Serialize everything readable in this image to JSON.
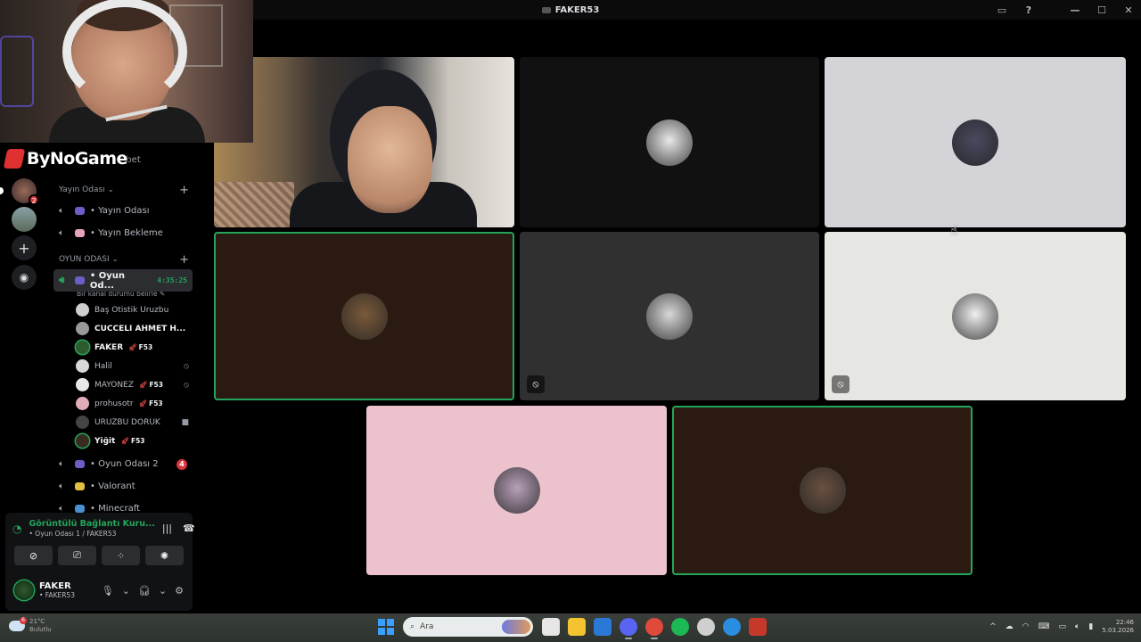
{
  "window": {
    "title": "FAKER53"
  },
  "overlay": {
    "brand": "ByNoGame",
    "hidden_channel_fragment": "hbet"
  },
  "rail": {
    "badge_count": "2"
  },
  "categories": [
    {
      "label": "Yayın Odası",
      "channels": [
        {
          "label": "• Yayın Odası",
          "emoji_color": "#6b5ec7"
        },
        {
          "label": "• Yayın Bekleme",
          "emoji_color": "#e7a3c0"
        }
      ]
    },
    {
      "label": "OYUN ODASI",
      "active_channel": {
        "label": "• Oyun Od...",
        "timer": "4:35:25",
        "status": "Bir kanal durumu belirle",
        "emoji_color": "#6b5ec7"
      },
      "users": [
        {
          "name": "Baş Otistik Uruzbu",
          "bold": false,
          "tag": "",
          "right": "",
          "avatar": "#cfcfcf",
          "speaking": false
        },
        {
          "name": "CÜCCELİ AHMET H...",
          "bold": true,
          "tag": "",
          "right": "",
          "avatar": "#9a9a9a",
          "speaking": false
        },
        {
          "name": "FAKER",
          "bold": true,
          "tag": "F53",
          "right": "",
          "avatar": "#2e5a2e",
          "speaking": true
        },
        {
          "name": "Halil",
          "bold": false,
          "tag": "",
          "right": "mic-off",
          "avatar": "#d8d8d8",
          "speaking": false
        },
        {
          "name": "MAYONEZ",
          "bold": false,
          "tag": "F53",
          "right": "mic-off",
          "avatar": "#e8e8e8",
          "speaking": false
        },
        {
          "name": "prohusotr",
          "bold": false,
          "tag": "F53",
          "right": "",
          "avatar": "#e0aeb8",
          "speaking": false
        },
        {
          "name": "URUZBU DORUK",
          "bold": false,
          "tag": "",
          "right": "camera",
          "avatar": "#444",
          "speaking": false
        },
        {
          "name": "Yiğit",
          "bold": true,
          "tag": "F53",
          "right": "",
          "avatar": "#3a2a20",
          "speaking": true
        }
      ],
      "more_channels": [
        {
          "label": "• Oyun Odası 2",
          "count": "4",
          "emoji_color": "#6b5ec7"
        },
        {
          "label": "• Valorant",
          "count": "",
          "emoji_color": "#e0c040"
        },
        {
          "label": "• Minecraft",
          "count": "",
          "emoji_color": "#4a90d0"
        }
      ]
    }
  ],
  "voice_panel": {
    "title": "Görüntülü Bağlantı Kuru...",
    "subtitle": "• Oyun Odası 1 / FAKER53",
    "user": {
      "name": "FAKER",
      "status": "• FAKER53"
    }
  },
  "stage": {
    "tiles": [
      {
        "kind": "camera",
        "speaking": false,
        "muted": false
      },
      {
        "kind": "avatar",
        "bg": "#111111",
        "avatar": "#e8e8e8",
        "speaking": false,
        "muted": false
      },
      {
        "kind": "avatar",
        "bg": "#d4d4d8",
        "avatar": "#4a4a60",
        "speaking": false,
        "muted": false
      },
      {
        "kind": "avatar",
        "bg": "#2b1a12",
        "avatar": "#7a5a3a",
        "speaking": true,
        "muted": false
      },
      {
        "kind": "avatar",
        "bg": "#303030",
        "avatar": "#d8d8d8",
        "speaking": false,
        "muted": true
      },
      {
        "kind": "avatar",
        "bg": "#e6e6e2",
        "avatar": "#f0f0f0",
        "speaking": false,
        "muted": true
      },
      {
        "kind": "avatar",
        "bg": "#ecc3cc",
        "avatar": "#b8a0b8",
        "speaking": false,
        "muted": false
      },
      {
        "kind": "avatar",
        "bg": "#2b1a12",
        "avatar": "#6a5040",
        "speaking": true,
        "muted": false
      }
    ]
  },
  "taskbar": {
    "search_placeholder": "Ara",
    "weather_badge": "6",
    "weather_text": "21°C\nBulutlu",
    "clock_time": "22:46",
    "clock_date": "5.03.2026",
    "apps": [
      {
        "name": "task-view",
        "color": "#e6e6e6"
      },
      {
        "name": "file-explorer",
        "color": "#f4c430"
      },
      {
        "name": "store",
        "color": "#2b79d6"
      },
      {
        "name": "discord",
        "color": "#5865f2"
      },
      {
        "name": "chrome",
        "color": "#e04a3a"
      },
      {
        "name": "spotify",
        "color": "#1db954"
      },
      {
        "name": "steam-like",
        "color": "#cfcfcf"
      },
      {
        "name": "browser-blue",
        "color": "#2a8de0"
      },
      {
        "name": "adobe",
        "color": "#c8382a"
      }
    ]
  }
}
